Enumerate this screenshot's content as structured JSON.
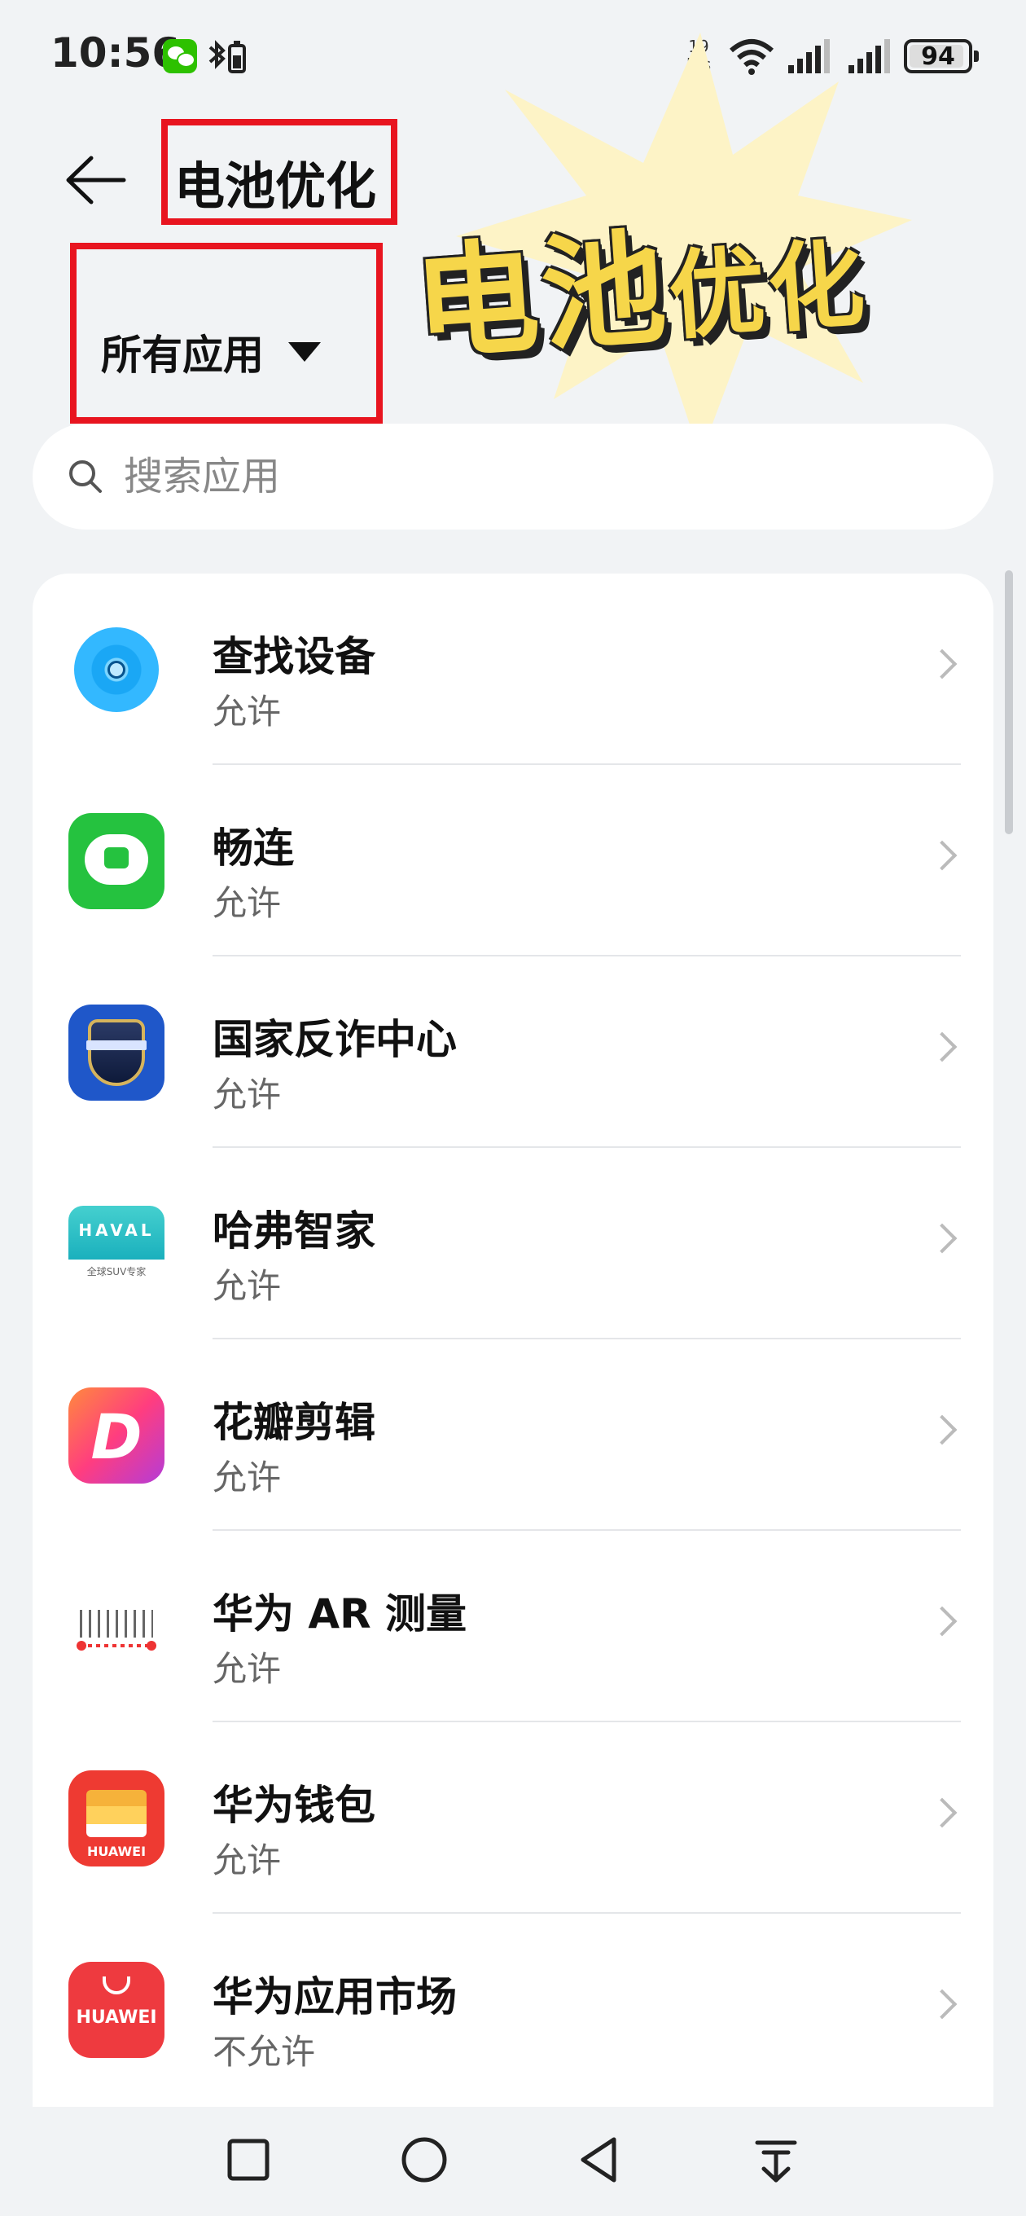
{
  "status_bar": {
    "time": "10:56",
    "speed_top": "19",
    "speed_bottom": "K/s",
    "battery": "94",
    "battery_level": 0.94,
    "icons": [
      "wechat-icon",
      "bluetooth-icon",
      "wifi-icon",
      "signal-icon",
      "signal-icon",
      "battery-icon"
    ]
  },
  "header": {
    "title": "电池优化",
    "back_icon": "arrow-left-icon"
  },
  "overlay": {
    "burst_text_big": "电池",
    "burst_text_small": "优化",
    "highlight_color": "#e8141f",
    "burst_color": "#f6d64a"
  },
  "filter": {
    "label": "所有应用"
  },
  "search": {
    "placeholder": "搜索应用"
  },
  "apps": [
    {
      "name": "查找设备",
      "status": "允许"
    },
    {
      "name": "畅连",
      "status": "允许"
    },
    {
      "name": "国家反诈中心",
      "status": "允许"
    },
    {
      "name": "哈弗智家",
      "status": "允许"
    },
    {
      "name": "花瓣剪辑",
      "status": "允许"
    },
    {
      "name": "华为 AR 测量",
      "status": "允许"
    },
    {
      "name": "华为钱包",
      "status": "允许"
    },
    {
      "name": "华为应用市场",
      "status": "不允许"
    }
  ],
  "icon_text": {
    "haval": "HAVAL",
    "haval_sub": "全球SUV专家",
    "petal": "D",
    "huawei": "HUAWEI"
  },
  "nav_bar": {
    "icons": [
      "square-recents-icon",
      "circle-home-icon",
      "triangle-back-icon",
      "notification-pull-icon"
    ]
  }
}
